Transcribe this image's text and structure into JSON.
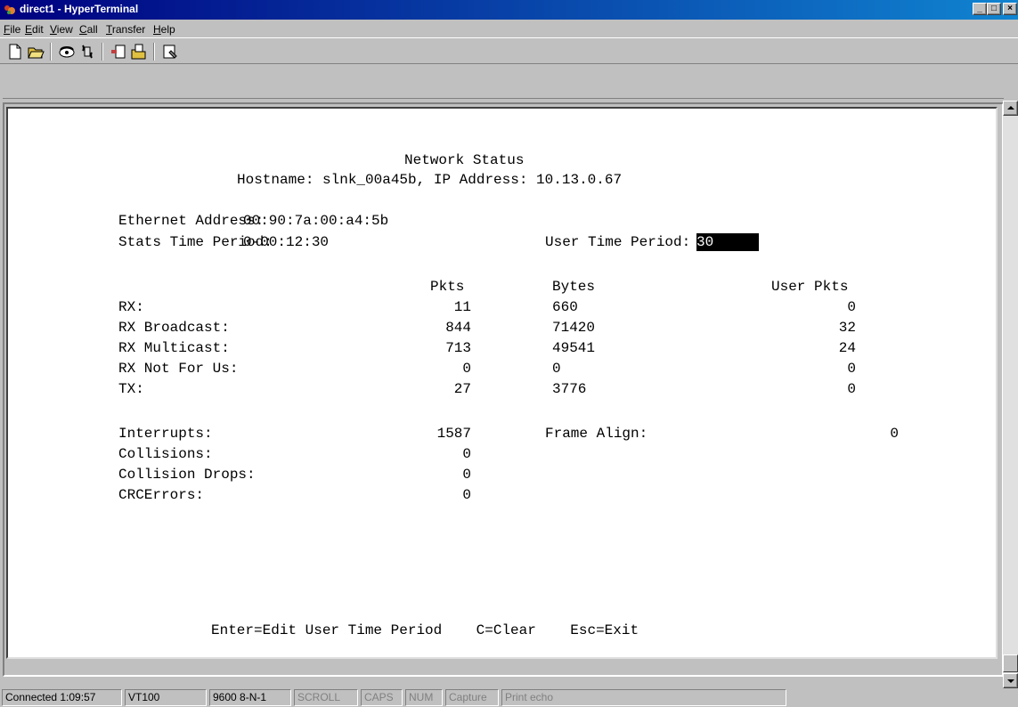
{
  "window": {
    "title": "direct1 - HyperTerminal",
    "controls": {
      "minimize": "_",
      "maximize": "□",
      "close": "×"
    }
  },
  "menu": {
    "items": [
      {
        "label": "File",
        "mnemonic": "F"
      },
      {
        "label": "Edit",
        "mnemonic": "E"
      },
      {
        "label": "View",
        "mnemonic": "V"
      },
      {
        "label": "Call",
        "mnemonic": "C"
      },
      {
        "label": "Transfer",
        "mnemonic": "T"
      },
      {
        "label": "Help",
        "mnemonic": "H"
      }
    ]
  },
  "toolbar": {
    "buttons": [
      {
        "name": "new-icon"
      },
      {
        "name": "open-icon"
      },
      {
        "name": "connect-icon"
      },
      {
        "name": "disconnect-icon"
      },
      {
        "name": "send-icon"
      },
      {
        "name": "receive-icon"
      },
      {
        "name": "properties-icon"
      }
    ]
  },
  "terminal": {
    "heading": "Network Status",
    "host_line": "Hostname: slnk_00a45b, IP Address: 10.13.0.67",
    "ethernet_label": "Ethernet Address:",
    "ethernet_value": "00:90:7a:00:a4:5b",
    "stats_label": "Stats Time Period:",
    "stats_value": "0-00:12:30",
    "user_period_label": "User Time Period:",
    "user_period_value": "30",
    "columns": [
      "Pkts",
      "Bytes",
      "User Pkts"
    ],
    "rows": [
      {
        "label": "RX:",
        "pkts": "11",
        "bytes": "660",
        "user": "0"
      },
      {
        "label": "RX Broadcast:",
        "pkts": "844",
        "bytes": "71420",
        "user": "32"
      },
      {
        "label": "RX Multicast:",
        "pkts": "713",
        "bytes": "49541",
        "user": "24"
      },
      {
        "label": "RX Not For Us:",
        "pkts": "0",
        "bytes": "0",
        "user": "0"
      },
      {
        "label": "TX:",
        "pkts": "27",
        "bytes": "3776",
        "user": "0"
      }
    ],
    "errors": [
      {
        "label": "Interrupts:",
        "value": "1587"
      },
      {
        "label": "Collisions:",
        "value": "0"
      },
      {
        "label": "Collision Drops:",
        "value": "0"
      },
      {
        "label": "CRCErrors:",
        "value": "0"
      }
    ],
    "frame_align_label": "Frame Align:",
    "frame_align_value": "0",
    "footer": "Enter=Edit User Time Period    C=Clear    Esc=Exit"
  },
  "statusbar": {
    "connected": "Connected 1:09:57",
    "emulation": "VT100",
    "settings": "9600 8-N-1",
    "scroll": "SCROLL",
    "caps": "CAPS",
    "num": "NUM",
    "capture": "Capture",
    "print_echo": "Print echo"
  }
}
